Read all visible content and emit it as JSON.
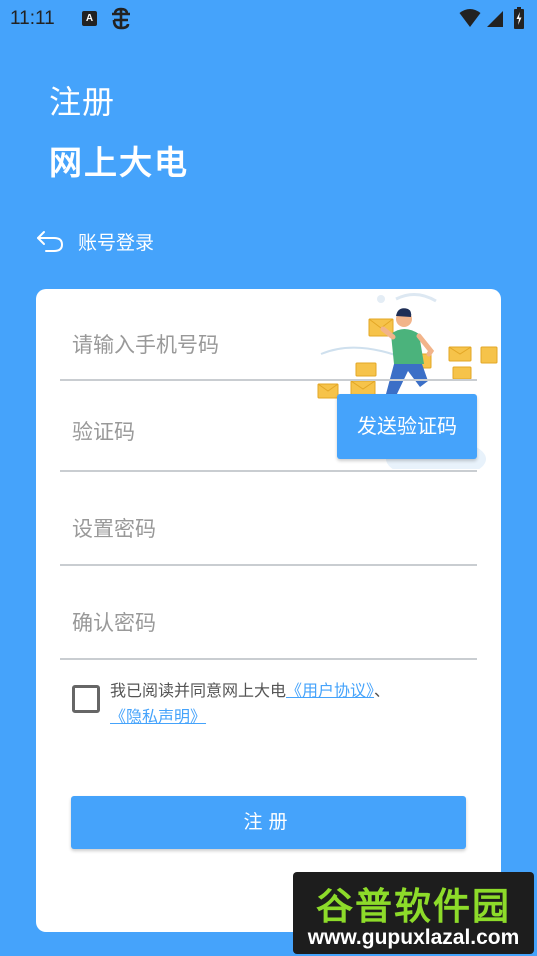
{
  "status_bar": {
    "time": "11:11",
    "a_badge": "A",
    "icons": [
      "notification-a-icon",
      "bug-icon",
      "wifi-icon",
      "cell-signal-icon",
      "battery-icon"
    ]
  },
  "header": {
    "title": "注册",
    "subtitle": "网上大电"
  },
  "back": {
    "icon": "back-arrow-icon",
    "label": "账号登录"
  },
  "form": {
    "phone_placeholder": "请输入手机号码",
    "code_placeholder": "验证码",
    "send_code_label": "发送验证码",
    "password_placeholder": "设置密码",
    "confirm_placeholder": "确认密码"
  },
  "agreement": {
    "text": "我已阅读并同意网上大电",
    "user_agreement": "《用户协议》",
    "separator": "、",
    "privacy": "《隐私声明》"
  },
  "submit_label": "注册",
  "watermark": {
    "title": "谷普软件园",
    "url": "www.gupuxlazal.com"
  },
  "colors": {
    "primary": "#45a3fb",
    "card": "#ffffff",
    "placeholder": "#999999",
    "divider": "#c9cdd1"
  }
}
